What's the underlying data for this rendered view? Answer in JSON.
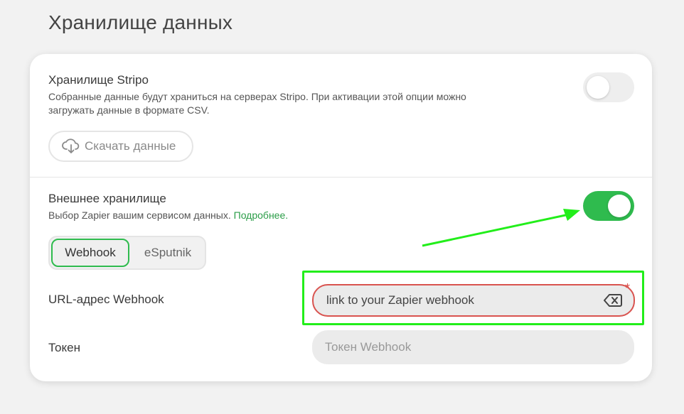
{
  "page": {
    "title": "Хранилище данных"
  },
  "stripo": {
    "title": "Хранилище Stripo",
    "description_line1": "Собранные данные будут храниться на серверах Stripo. При активации этой опции можно",
    "description_line2": "загружать данные в формате CSV.",
    "toggle_on": false,
    "download_label": "Скачать данные",
    "download_icon": "cloud-download-icon"
  },
  "external": {
    "title": "Внешнее хранилище",
    "description": "Выбор Zapier вашим сервисом данных.",
    "more_link": "Подробнее.",
    "toggle_on": true,
    "tabs": [
      {
        "label": "Webhook",
        "active": true
      },
      {
        "label": "eSputnik",
        "active": false
      }
    ],
    "url_label": "URL-адрес Webhook",
    "url_value": "link to your Zapier webhook",
    "required_mark": "*",
    "token_label": "Токен",
    "token_placeholder": "Токен Webhook"
  },
  "colors": {
    "accent": "#2fbb4e",
    "error": "#d9534f",
    "annotation": "#22ee1a"
  }
}
